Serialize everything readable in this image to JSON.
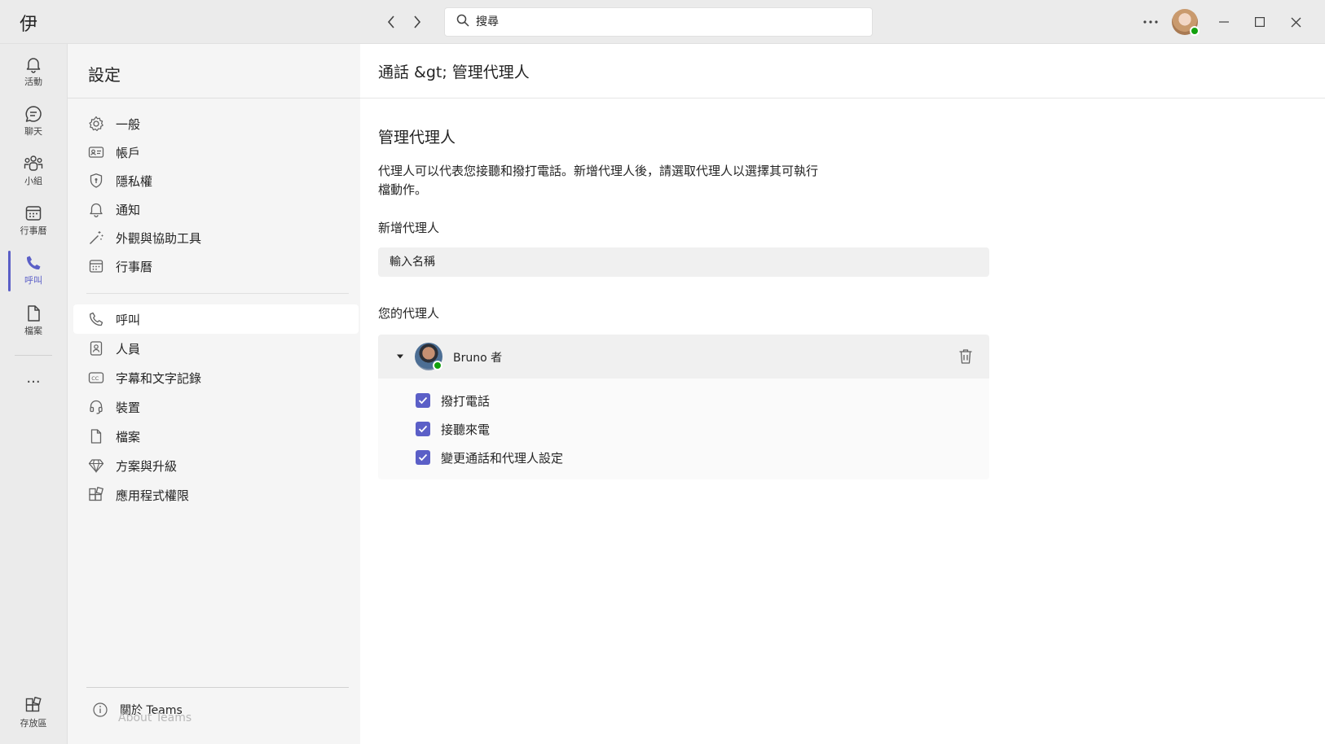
{
  "titlebar": {
    "app_glyph": "伊",
    "search_placeholder": "搜尋",
    "more_icon": "more-horizontal-icon",
    "window_controls": [
      "minimize-icon",
      "maximize-icon",
      "close-icon"
    ]
  },
  "rail": {
    "items": [
      {
        "label": "活動",
        "icon": "bell-icon"
      },
      {
        "label": "聊天",
        "icon": "chat-icon"
      },
      {
        "label": "小組",
        "icon": "teams-icon"
      },
      {
        "label": "行事曆",
        "icon": "calendar-icon"
      },
      {
        "label": "呼叫",
        "icon": "phone-icon",
        "active": true
      },
      {
        "label": "檔案",
        "icon": "file-icon"
      }
    ],
    "more_label": "...",
    "store_label": "存放區"
  },
  "settings": {
    "title": "設定",
    "items": [
      {
        "label": "一般",
        "icon": "gear-icon"
      },
      {
        "label": "帳戶",
        "icon": "contact-card-icon"
      },
      {
        "label": "隱私權",
        "icon": "shield-icon"
      },
      {
        "label": "通知",
        "icon": "bell-icon"
      },
      {
        "label": "外觀與協助工具",
        "icon": "magic-wand-icon"
      },
      {
        "label": "行事曆",
        "icon": "calendar-icon"
      },
      {
        "label": "呼叫",
        "icon": "phone-icon",
        "selected": true
      },
      {
        "label": "人員",
        "icon": "person-icon"
      },
      {
        "label": "字幕和文字記錄",
        "icon": "closed-caption-icon"
      },
      {
        "label": "裝置",
        "icon": "headset-icon"
      },
      {
        "label": "檔案",
        "icon": "file-icon"
      },
      {
        "label": "方案與升級",
        "icon": "diamond-icon"
      },
      {
        "label": "應用程式權限",
        "icon": "apps-icon"
      }
    ],
    "about_label": "關於 Teams",
    "about_ghost": "About Teams"
  },
  "main": {
    "breadcrumb": "通話 &gt;  管理代理人",
    "section_title": "管理代理人",
    "description": "代理人可以代表您接聽和撥打電話。新增代理人後，請選取代理人以選擇其可執行檔動作。",
    "add_label": "新增代理人",
    "name_placeholder": "輸入名稱",
    "your_delegates": "您的代理人",
    "delegate": {
      "name": "Bruno 者",
      "permissions": [
        {
          "label": "撥打電話",
          "checked": true
        },
        {
          "label": "接聽來電",
          "checked": true
        },
        {
          "label": "變更通話和代理人設定",
          "checked": true
        }
      ]
    }
  },
  "colors": {
    "accent": "#5b5fc7",
    "presence": "#13a10e"
  }
}
